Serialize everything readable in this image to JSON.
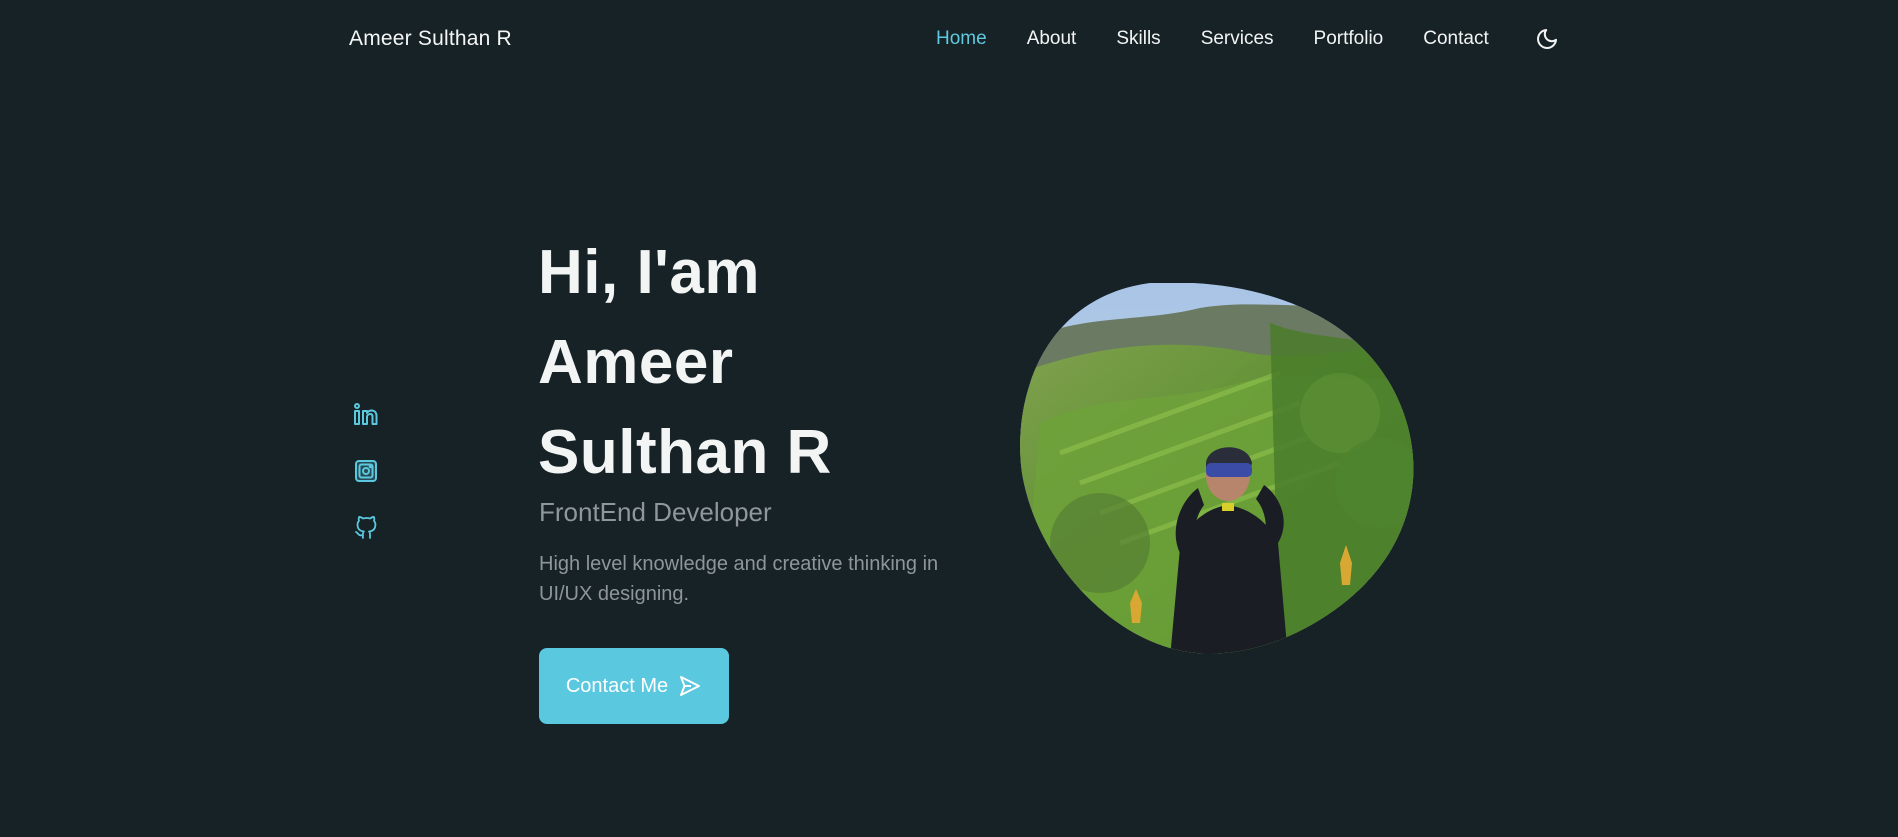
{
  "header": {
    "logo": "Ameer Sulthan R",
    "nav": [
      {
        "label": "Home",
        "active": true
      },
      {
        "label": "About",
        "active": false
      },
      {
        "label": "Skills",
        "active": false
      },
      {
        "label": "Services",
        "active": false
      },
      {
        "label": "Portfolio",
        "active": false
      },
      {
        "label": "Contact",
        "active": false
      }
    ],
    "theme_toggle_icon": "moon-icon"
  },
  "social": [
    {
      "icon": "linkedin-icon"
    },
    {
      "icon": "instagram-icon"
    },
    {
      "icon": "github-icon"
    }
  ],
  "hero": {
    "title_lines": [
      "Hi, I'am",
      "Ameer",
      "Sulthan R"
    ],
    "subtitle": "FrontEnd Developer",
    "description": "High level knowledge and creative thinking in UI/UX designing.",
    "cta_label": "Contact Me",
    "cta_icon": "send-icon",
    "photo": "profile-photo"
  },
  "colors": {
    "background": "#172226",
    "accent": "#5ac8df",
    "active_nav": "#5fc9e0",
    "muted_text": "#8e969a"
  }
}
